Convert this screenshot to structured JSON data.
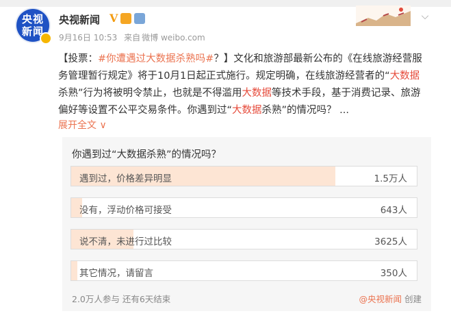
{
  "header": {
    "avatar_text": [
      "央视",
      "新闻"
    ],
    "author": "央视新闻",
    "verified_mark": "V",
    "date": "9月16日 10:53",
    "source_prefix": "来自",
    "source": "微博 weibo.com"
  },
  "post": {
    "parts": [
      {
        "text": "【投票：",
        "style": "normal"
      },
      {
        "text": "#你遭遇过大数据杀熟吗#",
        "style": "link"
      },
      {
        "text": "？】文化和旅游部最新公布的《在线旅游经营服务管理暂行规定》将于10月1日起正式施行。规定明确，在线旅游经营者的“",
        "style": "normal"
      },
      {
        "text": "大数据",
        "style": "red"
      },
      {
        "text": "杀熟”行为将被明令禁止，也就是不得滥用",
        "style": "normal"
      },
      {
        "text": "大数据",
        "style": "red"
      },
      {
        "text": "等技术手段，基于消费记录、旅游偏好等设置不公平交易条件。你遇到过“",
        "style": "normal"
      },
      {
        "text": "大数据",
        "style": "red"
      },
      {
        "text": "杀熟”的情况吗？ ...",
        "style": "normal"
      }
    ],
    "expand_label": "展开全文 ∨"
  },
  "vote": {
    "question": "你遇到过“大数据杀熟”的情况吗？",
    "options": [
      {
        "label": "遇到过，价格差异明显",
        "count": "1.5万人",
        "fraction": 0.765
      },
      {
        "label": "没有，浮动价格可接受",
        "count": "643人",
        "fraction": 0.032
      },
      {
        "label": "说不清，未进行过比较",
        "count": "3625人",
        "fraction": 0.181
      },
      {
        "label": "其它情况，请留言",
        "count": "350人",
        "fraction": 0.018
      }
    ],
    "footer": "2.0万人参与 还有6天结束",
    "creator_name": "@央视新闻",
    "creator_suffix": " 创建"
  },
  "colors": {
    "accent": "#eb7350",
    "brand_blue": "#1f52c4",
    "bar_fill": "#fde5d4"
  }
}
